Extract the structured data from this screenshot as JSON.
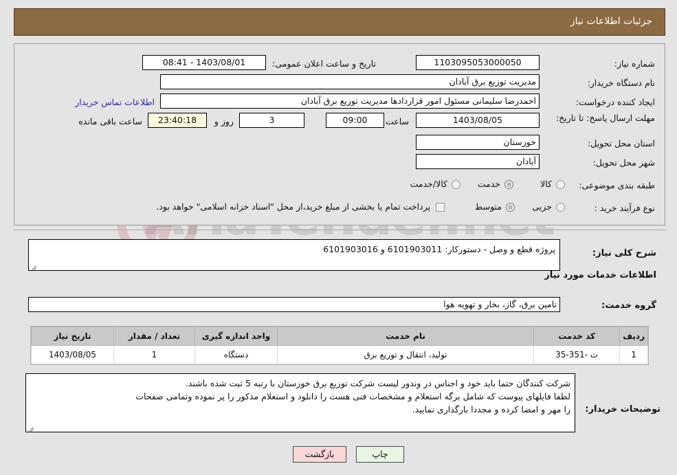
{
  "header": {
    "title": "جزئیات اطلاعات نیاز"
  },
  "info": {
    "need_number_label": "شماره نیاز:",
    "need_number_value": "1103095053000050",
    "buyer_org_label": "نام دستگاه خریدار:",
    "buyer_org_value": "مدیریت توزیع برق آبادان",
    "creator_label": "ایجاد کننده درخواست:",
    "creator_value": "احمدرضا سلیمانی مسئول امور قراردادها مدیریت توزیع برق آبادان",
    "deadline_label": "مهلت ارسال پاسخ: تا تاریخ:",
    "deadline_date": "1403/08/05",
    "hour_label": "ساعت",
    "deadline_time": "09:00",
    "province_label": "استان محل تحویل:",
    "province_value": "خوزستان",
    "city_label": "شهر محل تحویل:",
    "city_value": "آبادان",
    "announce_label": "تاریخ و ساعت اعلان عمومی:",
    "announce_value": "1403/08/01 - 08:41",
    "contact_link": "اطلاعات تماس خریدار",
    "days_value": "3",
    "days_unit": "روز و",
    "countdown_value": "23:40:18",
    "countdown_unit": "ساعت باقی مانده",
    "category_label": "طبقه بندی موضوعی:",
    "category_options": [
      {
        "label": "کالا",
        "selected": false
      },
      {
        "label": "خدمت",
        "selected": true
      },
      {
        "label": "کالا/خدمت",
        "selected": false
      }
    ],
    "process_label": "نوع فرآیند خرید :",
    "process_options": [
      {
        "label": "جزیی",
        "selected": false
      },
      {
        "label": "متوسط",
        "selected": true
      }
    ],
    "treasury_checkbox_text": "پرداخت تمام یا بخشی از مبلغ خرید،از محل \"اسناد خزانه اسلامی\" خواهد بود.",
    "treasury_checked": false
  },
  "description": {
    "general_label": "شرح کلی نیاز:",
    "general_value": "پروژه قطع و وصل - دستورکار: 6101903011 و 6101903016",
    "services_heading": "اطلاعات خدمات مورد نیاز",
    "service_group_label": "گروه خدمت:",
    "service_group_value": "تامین برق، گاز، بخار و تهویه هوا"
  },
  "table": {
    "headers": [
      "ردیف",
      "کد خدمت",
      "نام خدمت",
      "واحد اندازه گیری",
      "تعداد / مقدار",
      "تاریخ نیاز"
    ],
    "rows": [
      {
        "row": "1",
        "service_code": "ت -351-35",
        "service_name": "تولید، انتقال و توزیع برق",
        "unit": "دستگاه",
        "quantity": "1",
        "need_date": "1403/08/05"
      }
    ]
  },
  "buyer_notes": {
    "label": "توضیحات خریدار:",
    "line1": "شرکت کنندگان حتما باید خود و اجناس در وندور لیست شرکت توزیع برق خوزستان با رتبه 5 ثبت شده باشند.",
    "line2": "لطفا فایلهای پیوست که شامل برگه استعلام و مشخصات فنی هست را دانلود و استعلام مذکور را پر نموده وتمامی صفحات",
    "line3": "را مهر و امضا کرده و مجددا بارگذاری نمایید."
  },
  "buttons": {
    "print": "چاپ",
    "back": "بازگشت"
  },
  "watermark": {
    "text": "AriaTender.net"
  },
  "colors": {
    "header_bg": "#8c6a42",
    "page_bg": "#e4e4e4",
    "link": "#2b2ba8",
    "timer_bg": "#fbf8dd",
    "print_btn": "#e9f5e3",
    "back_btn": "#fbd7d7"
  }
}
